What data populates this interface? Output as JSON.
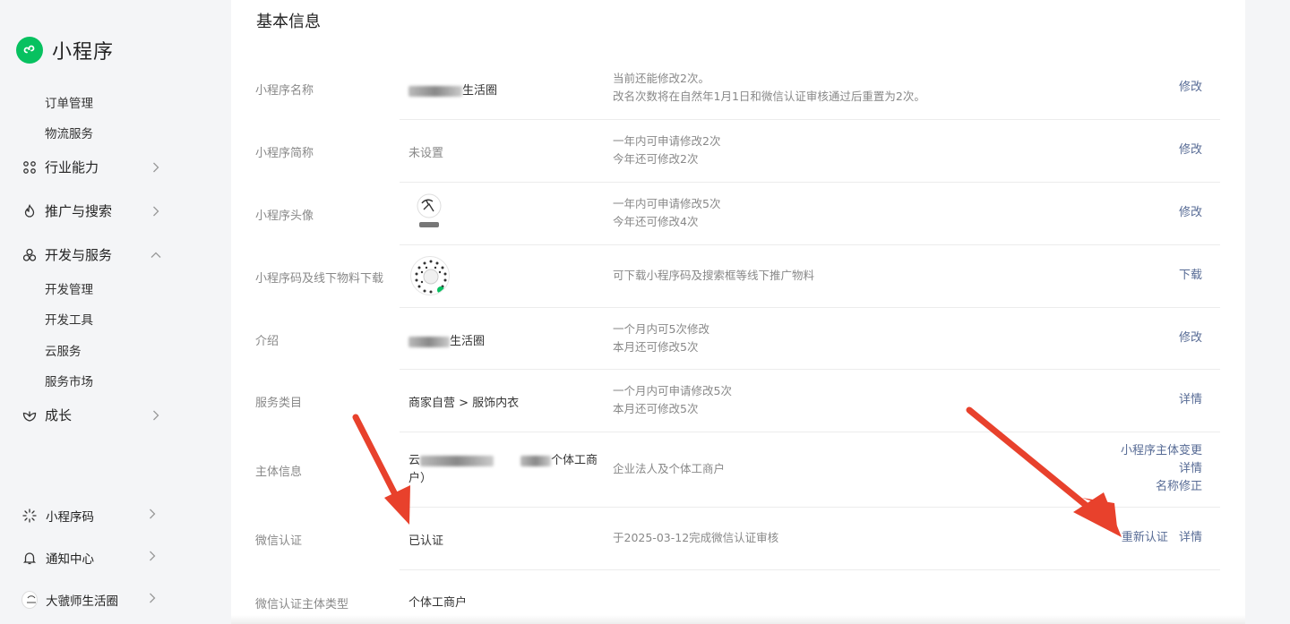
{
  "app": {
    "title": "小程序",
    "brand_color": "#07c160"
  },
  "sidebar": {
    "sub_top": [
      {
        "label": "订单管理"
      },
      {
        "label": "物流服务"
      }
    ],
    "main": [
      {
        "label": "行业能力",
        "icon": "industry-icon",
        "chevron": "right"
      },
      {
        "label": "推广与搜索",
        "icon": "flame-icon",
        "chevron": "right"
      },
      {
        "label": "开发与服务",
        "icon": "dev-icon",
        "chevron": "up"
      }
    ],
    "dev_sub": [
      {
        "label": "开发管理"
      },
      {
        "label": "开发工具"
      },
      {
        "label": "云服务"
      },
      {
        "label": "服务市场"
      }
    ],
    "growth": {
      "label": "成长",
      "icon": "growth-icon"
    },
    "bottom": [
      {
        "label": "小程序码",
        "icon": "qrcode-icon"
      },
      {
        "label": "通知中心",
        "icon": "bell-icon"
      },
      {
        "label": "大虢师生活圈",
        "icon": "avatar"
      }
    ]
  },
  "section": {
    "title": "基本信息"
  },
  "rows": {
    "name": {
      "label": "小程序名称",
      "value": "生活圈",
      "desc1": "当前还能修改2次。",
      "desc2": "改名次数将在自然年1月1日和微信认证审核通过后重置为2次。",
      "action": "修改"
    },
    "short": {
      "label": "小程序简称",
      "value": "未设置",
      "desc1": "一年内可申请修改2次",
      "desc2": "今年还可修改2次",
      "action": "修改"
    },
    "avatar": {
      "label": "小程序头像",
      "desc1": "一年内可申请修改5次",
      "desc2": "今年还可修改4次",
      "action": "修改"
    },
    "qrcode": {
      "label": "小程序码及线下物料下载",
      "desc1": "可下载小程序码及搜索框等线下推广物料",
      "action": "下载"
    },
    "intro": {
      "label": "介绍",
      "value": "生活圈",
      "desc1": "一个月内可5次修改",
      "desc2": "本月还可修改5次",
      "action": "修改"
    },
    "category": {
      "label": "服务类目",
      "value": "商家自营 > 服饰内衣",
      "desc1": "一个月内可申请修改5次",
      "desc2": "本月还可修改5次",
      "action": "详情"
    },
    "entity": {
      "label": "主体信息",
      "value_start": "云",
      "value_end": "个体工商",
      "value_line2": "户）",
      "desc1": "企业法人及个体工商户",
      "action1": "小程序主体变更",
      "action2": "详情",
      "action3": "名称修正"
    },
    "wechat_cert": {
      "label": "微信认证",
      "value": "已认证",
      "desc1": "于2025-03-12完成微信认证审核",
      "action1": "重新认证",
      "action2": "详情"
    },
    "cert_type": {
      "label": "微信认证主体类型",
      "value": "个体工商户"
    }
  },
  "colors": {
    "link": "#576b95",
    "arrow": "#e8412c"
  }
}
